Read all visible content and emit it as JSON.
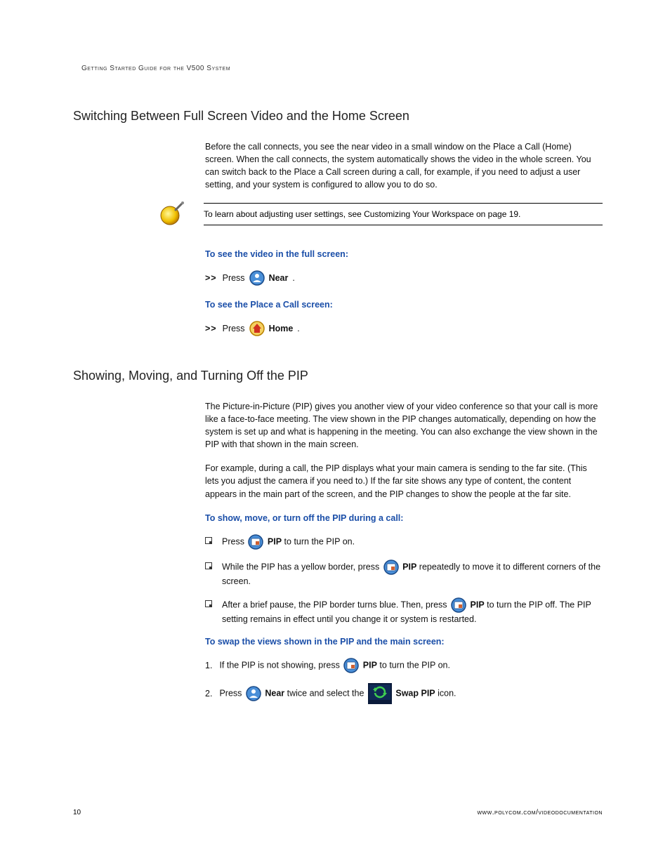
{
  "header": "Getting Started Guide for the V500 System",
  "section1": {
    "title": "Switching Between Full Screen Video and the Home Screen",
    "intro": "Before the call connects, you see the near video in a small window on the Place a Call (Home) screen. When the call connects, the system automatically shows the video in the whole screen. You can switch back to the Place a Call screen during a call, for example, if you need to adjust a user setting, and your system is configured to allow you to do so.",
    "note": "To learn about adjusting user settings, see Customizing Your Workspace on page 19.",
    "task1": {
      "heading": "To see the video in the full screen:",
      "press": "Press",
      "button": "Near"
    },
    "task2": {
      "heading": "To see the Place a Call screen:",
      "press": "Press",
      "button": "Home"
    }
  },
  "section2": {
    "title": "Showing, Moving, and Turning Off the PIP",
    "p1": "The Picture-in-Picture (PIP) gives you another view of your video conference so that your call is more like a face-to-face meeting. The view shown in the PIP changes automatically, depending on how the system is set up and what is happening in the meeting. You can also exchange the view shown in the PIP with that shown in the main screen.",
    "p2": "For example, during a call, the PIP displays what your main camera is sending to the far site. (This lets you adjust the camera if you need to.) If the far site shows any type of content, the content appears in the main part of the screen, and the PIP changes to show the people at the far site.",
    "task3": {
      "heading": "To show, move, or turn off the PIP during a call:",
      "i1a": "Press ",
      "i1b": "PIP",
      "i1c": " to turn the PIP on.",
      "i2a": "While the PIP has a yellow border, press ",
      "i2b": "PIP",
      "i2c": " repeatedly to move it to different corners of the screen.",
      "i3a": "After a brief pause, the PIP border turns blue. Then, press ",
      "i3b": "PIP",
      "i3c": " to turn the PIP off. The PIP setting remains in effect until you change it or system is restarted."
    },
    "task4": {
      "heading": "To swap the views shown in the PIP and the main screen:",
      "n1a": "If the PIP is not showing, press ",
      "n1b": "PIP",
      "n1c": " to turn the PIP on.",
      "n2a": "Press ",
      "n2b": "Near",
      "n2c": " twice and select the ",
      "n2d": "Swap PIP",
      "n2e": " icon."
    }
  },
  "footer": {
    "page": "10",
    "url": "www.polycom.com/videodocumentation"
  }
}
